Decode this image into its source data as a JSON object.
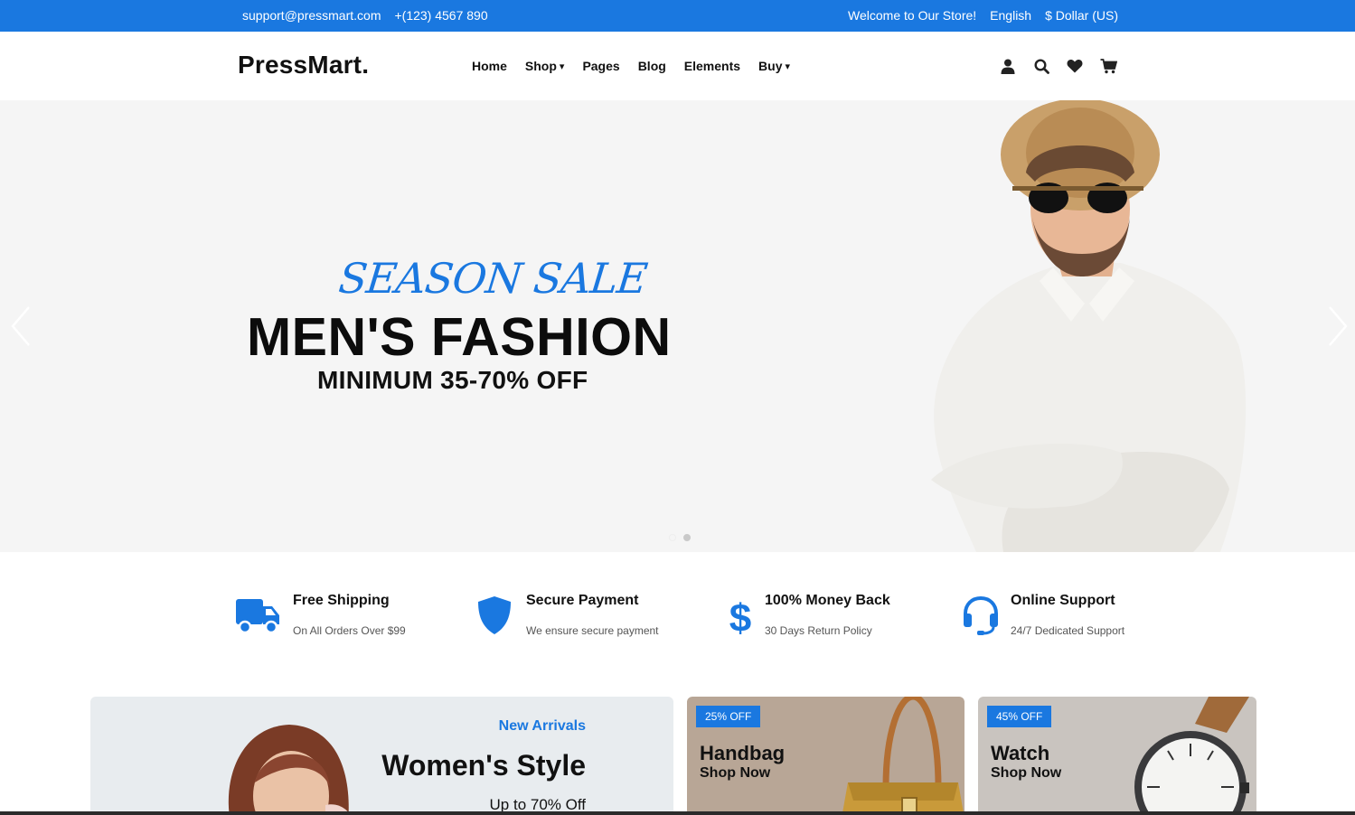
{
  "topbar": {
    "email": "support@pressmart.com",
    "phone": "+(123) 4567 890",
    "welcome": "Welcome to Our Store!",
    "language": "English",
    "currency": "$ Dollar (US)"
  },
  "header": {
    "logo": "PressMart.",
    "nav": [
      {
        "label": "Home",
        "caret": ""
      },
      {
        "label": "Shop",
        "caret": "▾"
      },
      {
        "label": "Pages",
        "caret": ""
      },
      {
        "label": "Blog",
        "caret": ""
      },
      {
        "label": "Elements",
        "caret": ""
      },
      {
        "label": "Buy",
        "caret": "▾"
      }
    ],
    "icons": [
      "user-icon",
      "search-icon",
      "heart-icon",
      "cart-icon"
    ]
  },
  "hero": {
    "script": "SEASON SALE",
    "headline": "MEN'S FASHION",
    "subheadline": "MINIMUM 35-70% OFF",
    "slides": 2,
    "active_slide": 1
  },
  "features": [
    {
      "icon": "truck-icon",
      "title": "Free Shipping",
      "desc": "On All Orders Over $99"
    },
    {
      "icon": "shield-icon",
      "title": "Secure Payment",
      "desc": "We ensure secure payment"
    },
    {
      "icon": "dollar-icon",
      "title": "100% Money Back",
      "desc": "30 Days Return Policy"
    },
    {
      "icon": "headset-icon",
      "title": "Online Support",
      "desc": "24/7 Dedicated Support"
    }
  ],
  "promos": {
    "women": {
      "tag": "New Arrivals",
      "title": "Women's Style",
      "offer": "Up to 70% Off"
    },
    "handbag": {
      "badge": "25% OFF",
      "title": "Handbag",
      "link": "Shop Now"
    },
    "watch": {
      "badge": "45% OFF",
      "title": "Watch",
      "link": "Shop Now"
    }
  },
  "colors": {
    "accent": "#1a78e0",
    "hero_bg": "#f5f5f5"
  }
}
